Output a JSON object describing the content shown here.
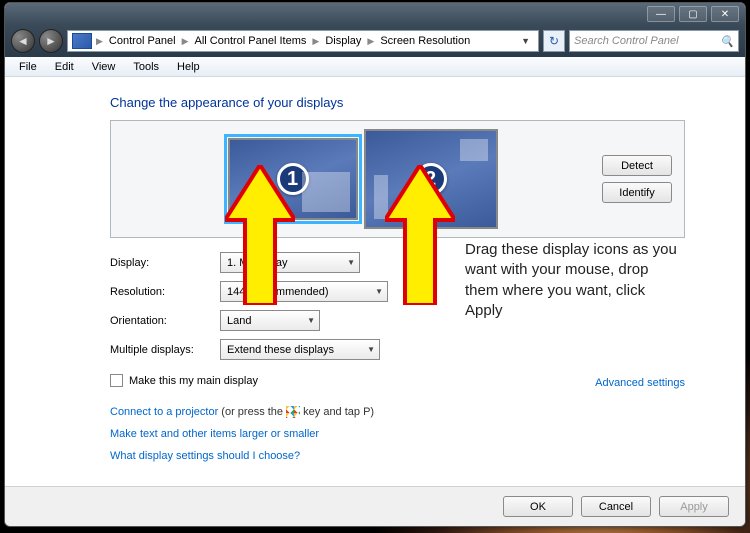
{
  "titlebar": {
    "minimize": "—",
    "maximize": "▢",
    "close": "✕"
  },
  "nav": {
    "back": "◄",
    "forward": "►",
    "refresh": "↻"
  },
  "breadcrumb": {
    "items": [
      "Control Panel",
      "All Control Panel Items",
      "Display",
      "Screen Resolution"
    ]
  },
  "search": {
    "placeholder": "Search Control Panel",
    "icon": "🔍"
  },
  "menu": {
    "items": [
      "File",
      "Edit",
      "View",
      "Tools",
      "Help"
    ]
  },
  "heading": "Change the appearance of your displays",
  "preview": {
    "mon1": "1",
    "mon2": "2",
    "detect": "Detect",
    "identify": "Identify"
  },
  "settings": {
    "display_label": "Display:",
    "display_value": "1. M           Display",
    "resolution_label": "Resolution:",
    "resolution_value": "1440         recommended)",
    "orientation_label": "Orientation:",
    "orientation_value": "Land",
    "multiple_label": "Multiple displays:",
    "multiple_value": "Extend these displays"
  },
  "main_display_chk": "Make this my main display",
  "advanced": "Advanced settings",
  "links": {
    "projector_a": "Connect to a projector",
    "projector_b": " (or press the ",
    "projector_c": " key and tap P)",
    "textsize": "Make text and other items larger or smaller",
    "whatchoose": "What display settings should I choose?"
  },
  "footer": {
    "ok": "OK",
    "cancel": "Cancel",
    "apply": "Apply"
  },
  "annotation": "Drag these display icons as you want with your mouse, drop them where you want, click Apply"
}
